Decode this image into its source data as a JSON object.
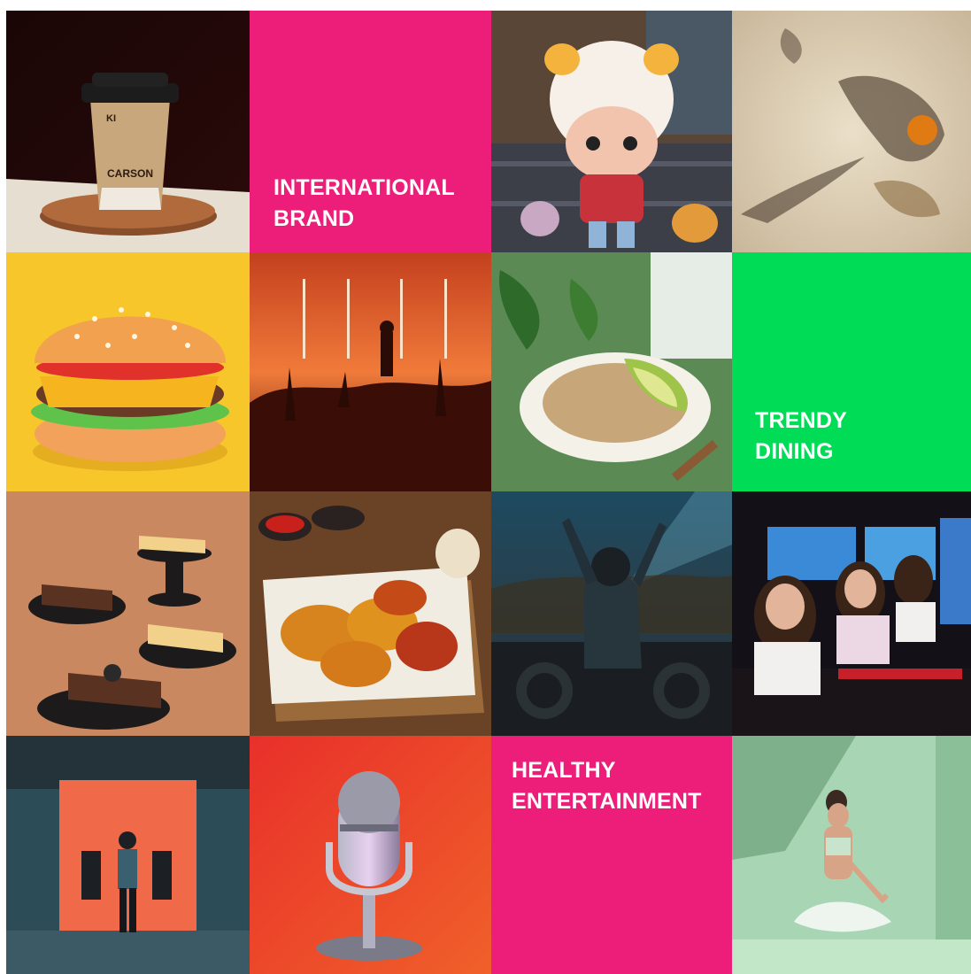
{
  "tiles": [
    {
      "name": "coffee-cup-image",
      "kind": "photo",
      "depicts": "coffee cup on wooden coaster",
      "cup_text": [
        "KI",
        "CARSON"
      ]
    },
    {
      "name": "international-brand-tile",
      "kind": "text",
      "lines": [
        "INTERNATIONAL",
        "BRAND"
      ],
      "color": "#ec1e79"
    },
    {
      "name": "toy-figure-image",
      "kind": "photo",
      "depicts": "designer toy figure on shelf"
    },
    {
      "name": "shadow-art-image",
      "kind": "photo",
      "depicts": "hand shadow art on beige wall"
    },
    {
      "name": "burger-image",
      "kind": "photo",
      "depicts": "3d cheeseburger on yellow"
    },
    {
      "name": "concert-image",
      "kind": "photo",
      "depicts": "concert crowd under orange lights"
    },
    {
      "name": "healthy-bowl-image",
      "kind": "photo",
      "depicts": "grain bowl with avocado"
    },
    {
      "name": "trendy-dining-tile",
      "kind": "text",
      "lines": [
        "TRENDY",
        "DINING"
      ],
      "color": "#00dc55"
    },
    {
      "name": "cheesecake-image",
      "kind": "photo",
      "depicts": "cheesecake slices on plates"
    },
    {
      "name": "fried-chicken-image",
      "kind": "photo",
      "depicts": "fried chicken on wooden board"
    },
    {
      "name": "dj-image",
      "kind": "photo",
      "depicts": "dj at decks facing crowd"
    },
    {
      "name": "esports-image",
      "kind": "photo",
      "depicts": "esports gamers with headsets"
    },
    {
      "name": "gym-image",
      "kind": "photo",
      "depicts": "man standing in gym"
    },
    {
      "name": "microphone-image",
      "kind": "photo",
      "depicts": "retro microphone on red"
    },
    {
      "name": "healthy-entertainment-tile",
      "kind": "text",
      "lines": [
        "HEALTHY",
        "ENTERTAINMENT"
      ],
      "color": "#ec1e79"
    },
    {
      "name": "yoga-image",
      "kind": "photo",
      "depicts": "woman meditating in green room"
    }
  ],
  "colors": {
    "brand_pink": "#ec1e79",
    "brand_green": "#00dc55"
  }
}
